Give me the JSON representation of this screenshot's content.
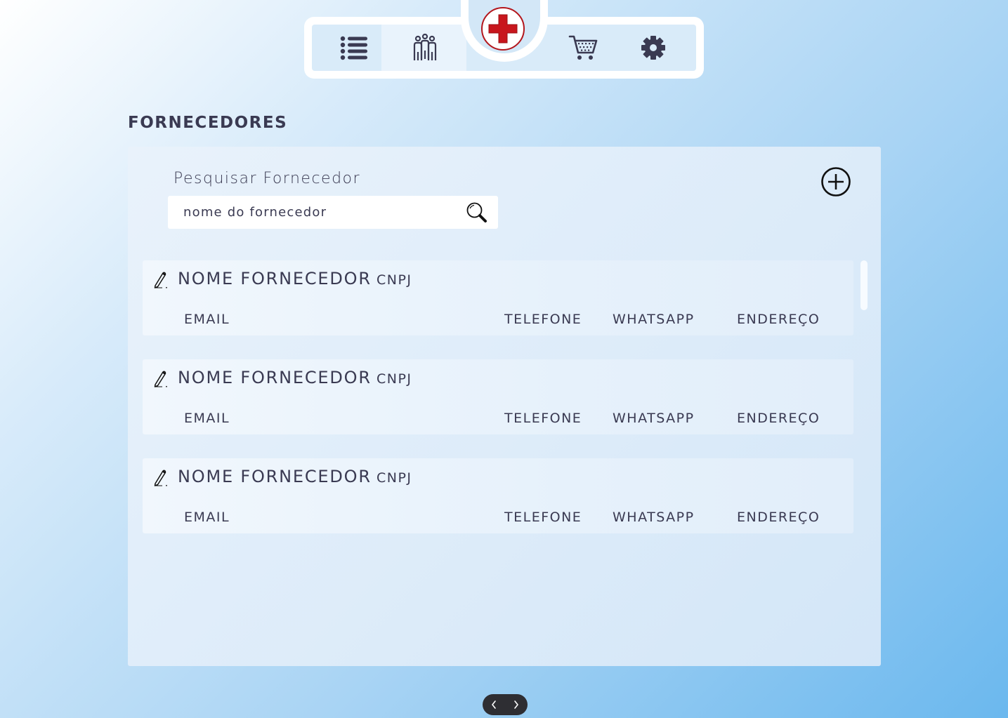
{
  "nav": {
    "items": [
      {
        "icon": "list-icon"
      },
      {
        "icon": "people-icon"
      },
      {
        "icon": "red-cross-logo"
      },
      {
        "icon": "cart-icon"
      },
      {
        "icon": "gear-icon"
      }
    ],
    "colors": {
      "logo_red": "#c8161d",
      "icon": "#3a3a52"
    }
  },
  "page": {
    "title": "FORNECEDORES"
  },
  "search": {
    "label": "Pesquisar Fornecedor",
    "placeholder": "nome do fornecedor",
    "value": ""
  },
  "suppliers": [
    {
      "name": "NOME FORNECEDOR",
      "cnpj": "CNPJ",
      "email": "EMAIL",
      "telefone": "TELEFONE",
      "whatsapp": "WHATSAPP",
      "endereco": "ENDEREÇO"
    },
    {
      "name": "NOME FORNECEDOR",
      "cnpj": "CNPJ",
      "email": "EMAIL",
      "telefone": "TELEFONE",
      "whatsapp": "WHATSAPP",
      "endereco": "ENDEREÇO"
    },
    {
      "name": "NOME FORNECEDOR",
      "cnpj": "CNPJ",
      "email": "EMAIL",
      "telefone": "TELEFONE",
      "whatsapp": "WHATSAPP",
      "endereco": "ENDEREÇO"
    }
  ],
  "pagination": {
    "prev": "‹",
    "next": "›"
  }
}
